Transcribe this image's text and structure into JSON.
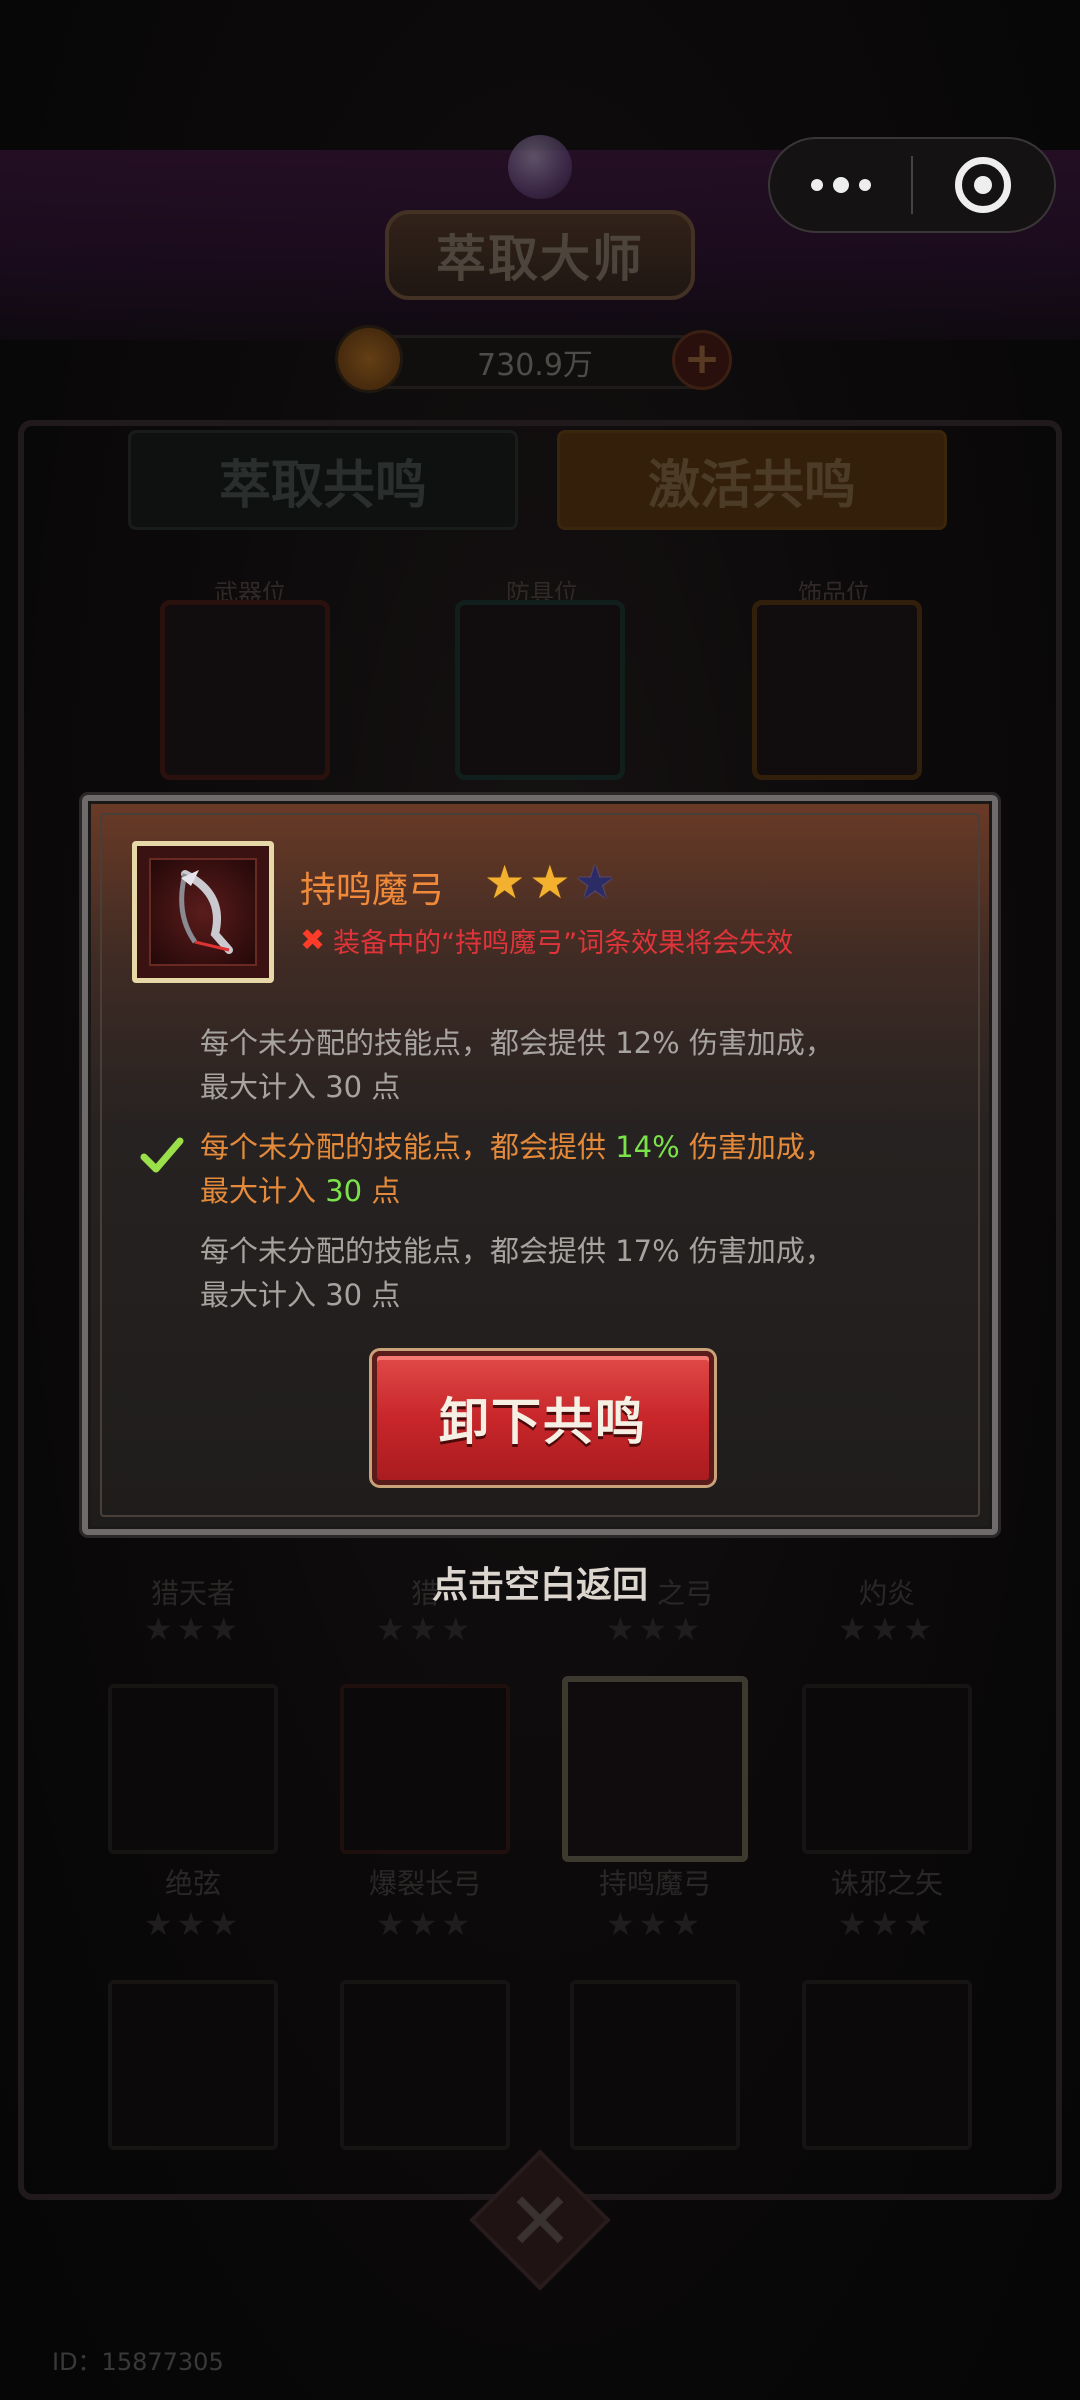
{
  "background": {
    "screen_title": "萃取大师",
    "currency_amount": "730.9万",
    "tabs": [
      {
        "label": "萃取共鸣"
      },
      {
        "label": "激活共鸣"
      }
    ],
    "slot_labels": [
      "武器位",
      "防具位",
      "饰品位"
    ],
    "grid_rows": [
      {
        "names": [
          "猎天者",
          "猎",
          "之弓",
          "灼炎"
        ]
      },
      {
        "names": [
          "绝弦",
          "爆裂长弓",
          "持鸣魔弓",
          "诛邪之矢"
        ]
      }
    ],
    "id_text": "ID：15877305"
  },
  "modal": {
    "item_name": "持鸣魔弓",
    "stars": {
      "filled": 2,
      "total": 3
    },
    "warning": "装备中的“持鸣魔弓”词条效果将会失效",
    "effects": [
      {
        "line1_prefix": "每个未分配的技能点，都会提供 ",
        "percent": "12%",
        "line1_suffix": " 伤害加成，",
        "line2_prefix": "最大计入 ",
        "count": "30",
        "line2_suffix": " 点",
        "active": false
      },
      {
        "line1_prefix": "每个未分配的技能点，都会提供 ",
        "percent": "14%",
        "line1_suffix": " 伤害加成，",
        "line2_prefix": "最大计入 ",
        "count": "30",
        "line2_suffix": " 点",
        "active": true
      },
      {
        "line1_prefix": "每个未分配的技能点，都会提供 ",
        "percent": "17%",
        "line1_suffix": " 伤害加成，",
        "line2_prefix": "最大计入 ",
        "count": "30",
        "line2_suffix": " 点",
        "active": false
      }
    ],
    "button_label": "卸下共鸣",
    "hint": "点击空白返回"
  },
  "colors": {
    "item_name": "#f08a3a",
    "warning": "#e0343a",
    "active_effect": "#e48a3a",
    "active_number": "#7be34a",
    "button_red": "#c8262a"
  }
}
